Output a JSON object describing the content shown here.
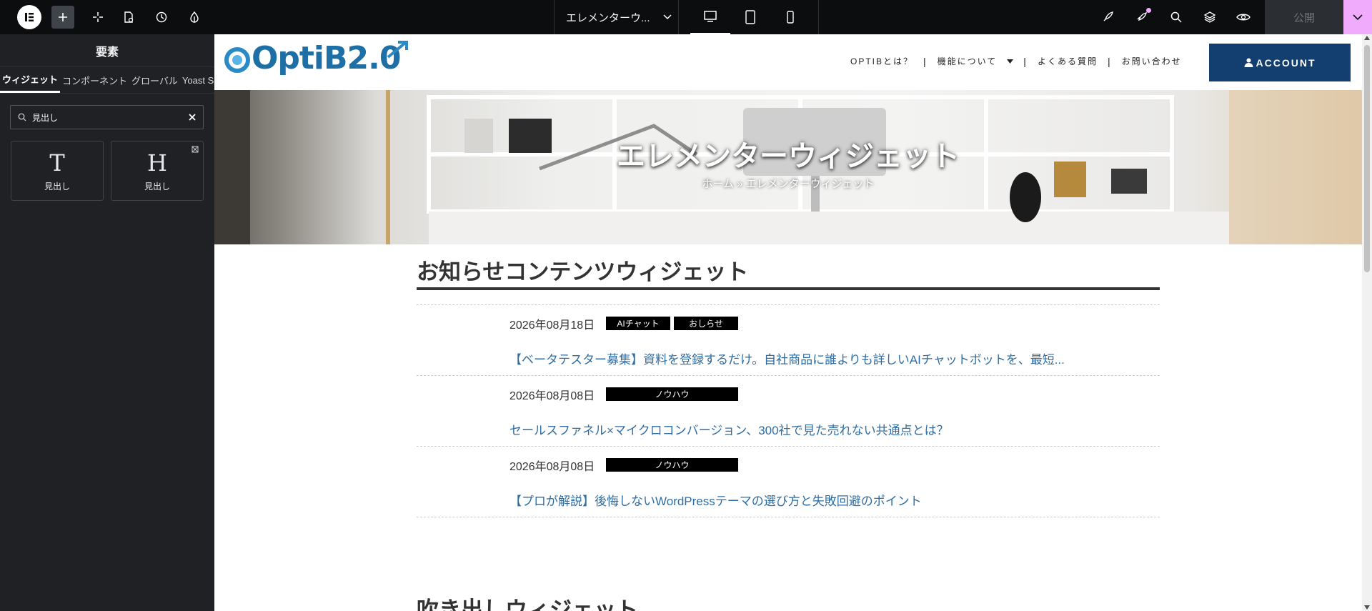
{
  "topbar": {
    "doc_title": "エレメンターウ...",
    "publish_label": "公開"
  },
  "panel": {
    "title": "要素",
    "tabs": [
      "ウィジェット",
      "コンポーネント",
      "グローバル",
      "Yoast SEO"
    ],
    "search_value": "見出し",
    "widgets": [
      {
        "glyph": "T",
        "label": "見出し"
      },
      {
        "glyph": "H",
        "label": "見出し"
      }
    ]
  },
  "site": {
    "brand": "OptiB2.0",
    "nav": [
      "OPTIBとは？",
      "機能について",
      "よくある質問",
      "お問い合わせ"
    ],
    "account_label": "ACCOUNT",
    "hero_title": "エレメンターウィジェット",
    "breadcrumb_home": "ホーム",
    "breadcrumb_sep": "»",
    "breadcrumb_current": "エレメンターウィジェット",
    "section1_title": "お知らせコンテンツウィジェット",
    "news": [
      {
        "date": "2026年08月18日",
        "tags": [
          "AIチャット",
          "おしらせ"
        ],
        "title": "【ベータテスター募集】資料を登録するだけ。自社商品に誰よりも詳しいAIチャットボットを、最短..."
      },
      {
        "date": "2026年08月08日",
        "tags": [
          "ノウハウ"
        ],
        "title": "セールスファネル×マイクロコンバージョン、300社で見た売れない共通点とは？"
      },
      {
        "date": "2026年08月08日",
        "tags": [
          "ノウハウ"
        ],
        "title": "【プロが解説】後悔しないWordPressテーマの選び方と失敗回避のポイント"
      }
    ],
    "section2_title": "吹き出しウィジェット"
  },
  "colors": {
    "accent_pink": "#f0abfc",
    "account_bg": "#123f70",
    "link": "#2e6da4"
  }
}
